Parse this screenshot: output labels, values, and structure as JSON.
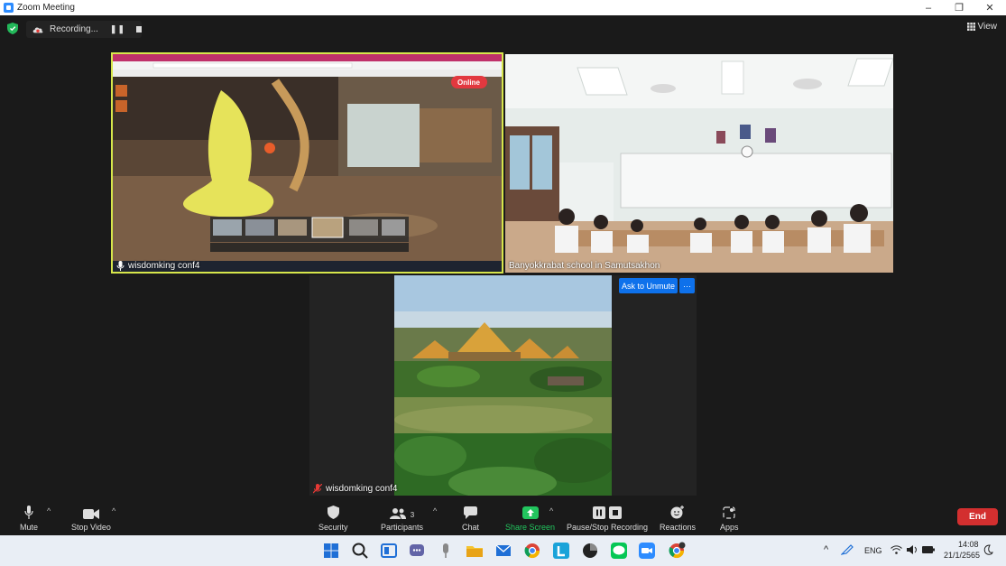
{
  "window": {
    "title": "Zoom Meeting"
  },
  "recording": {
    "status_label": "Recording...",
    "pause_icon": "pause-icon",
    "stop_icon": "stop-icon"
  },
  "view": {
    "label": "View"
  },
  "tiles": [
    {
      "name": "wisdomking conf4",
      "muted": false
    },
    {
      "name": "Banyokkrabat school in Samutsakhon",
      "muted": false
    },
    {
      "name": "wisdomking conf4",
      "muted": true
    }
  ],
  "shared_screen": {
    "badge": "Online"
  },
  "ask_to_unmute": {
    "label": "Ask to Unmute",
    "more": "···"
  },
  "toolbar": {
    "mute": "Mute",
    "stop_video": "Stop Video",
    "security": "Security",
    "participants": "Participants",
    "participants_count": "3",
    "chat": "Chat",
    "share_screen": "Share Screen",
    "pause_stop_recording": "Pause/Stop Recording",
    "reactions": "Reactions",
    "apps": "Apps",
    "end": "End"
  },
  "taskbar": {
    "language": "ENG",
    "time": "14:08",
    "date": "21/1/2565"
  },
  "colors": {
    "accent": "#0e71eb",
    "end": "#d32f2f",
    "share_green": "#22c55e",
    "speaker_border": "#d7e64b"
  }
}
